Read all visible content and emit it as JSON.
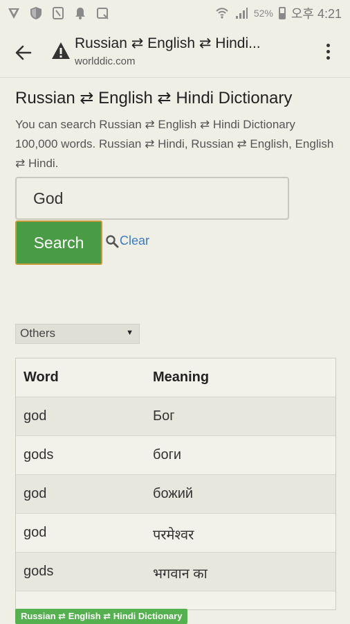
{
  "status_bar": {
    "battery_pct": "52%",
    "time": "오후 4:21",
    "icons": [
      "vpn-icon",
      "shield-icon",
      "nfc-icon",
      "notification-bell-icon",
      "screenshot-icon",
      "wifi-icon",
      "signal-icon",
      "battery-icon"
    ]
  },
  "browser": {
    "title": "Russian ⇄ English ⇄ Hindi...",
    "url": "worlddic.com"
  },
  "page": {
    "title": "Russian ⇄ English ⇄ Hindi Dictionary",
    "intro": "You can search Russian ⇄ English ⇄ Hindi Dictionary 100,000 words. Russian ⇄ Hindi, Russian ⇄ English, English ⇄ Hindi."
  },
  "search": {
    "value": "God",
    "button_label": "Search",
    "clear_label": "Clear"
  },
  "filter": {
    "selected": "Others"
  },
  "results": {
    "headers": [
      "Word",
      "Meaning"
    ],
    "rows": [
      {
        "word": "god",
        "meaning": "Бог"
      },
      {
        "word": "gods",
        "meaning": "боги"
      },
      {
        "word": "god",
        "meaning": "божий"
      },
      {
        "word": "god",
        "meaning": "परमेश्वर"
      },
      {
        "word": "gods",
        "meaning": "भगवान का"
      }
    ]
  },
  "footer": {
    "badge": "Russian ⇄ English ⇄ Hindi Dictionary"
  },
  "colors": {
    "background": "#f0efe6",
    "search_button": "#4a9b45",
    "link": "#3a7bbf",
    "badge": "#55b04f"
  }
}
